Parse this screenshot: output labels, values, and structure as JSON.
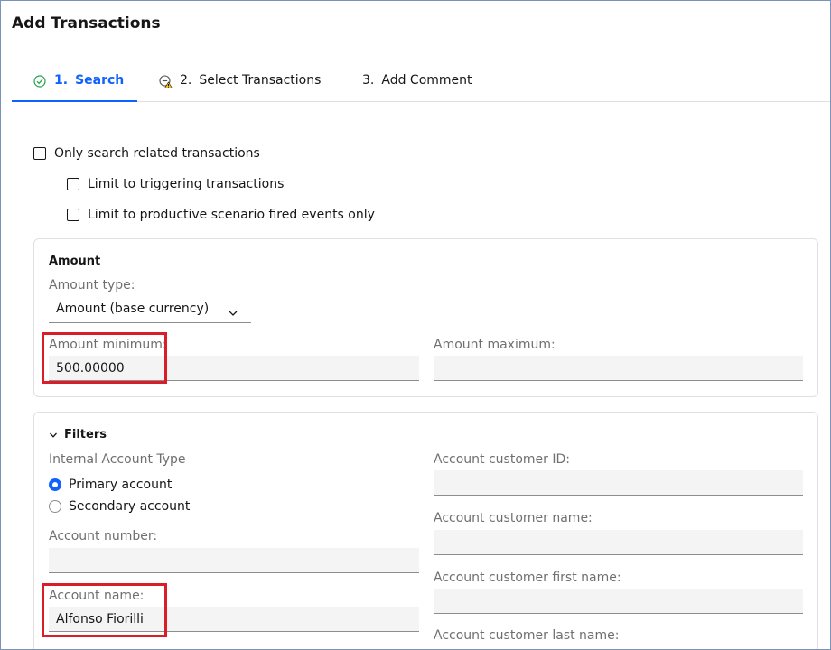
{
  "page_title": "Add Transactions",
  "tabs": [
    {
      "number": "1.",
      "label": "Search",
      "state": "active",
      "icon": "check-circle-icon"
    },
    {
      "number": "2.",
      "label": "Select Transactions",
      "state": "warning",
      "icon": "warning-icon"
    },
    {
      "number": "3.",
      "label": "Add Comment",
      "state": "default"
    }
  ],
  "options": {
    "related": "Only search related transactions",
    "triggering": "Limit to triggering transactions",
    "productive": "Limit to productive scenario fired events only"
  },
  "amount": {
    "heading": "Amount",
    "type_label": "Amount type:",
    "type_value": "Amount (base currency)",
    "min_label": "Amount minimum:",
    "min_value": "500.00000",
    "max_label": "Amount maximum:",
    "max_value": ""
  },
  "filters": {
    "heading": "Filters",
    "internal_account_type_label": "Internal Account Type",
    "radio_primary": "Primary account",
    "radio_secondary": "Secondary account",
    "selected": "Primary account",
    "account_number_label": "Account number:",
    "account_number_value": "",
    "account_name_label": "Account name:",
    "account_name_value": "Alfonso Fiorilli",
    "customer_id_label": "Account customer ID:",
    "customer_id_value": "",
    "customer_name_label": "Account customer name:",
    "customer_name_value": "",
    "customer_first_name_label": "Account customer first name:",
    "customer_first_name_value": "",
    "customer_last_name_label": "Account customer last name:"
  },
  "colors": {
    "accent": "#0f62fe",
    "highlight": "#da1e28",
    "warning": "#f1c21b",
    "success": "#24a148"
  }
}
